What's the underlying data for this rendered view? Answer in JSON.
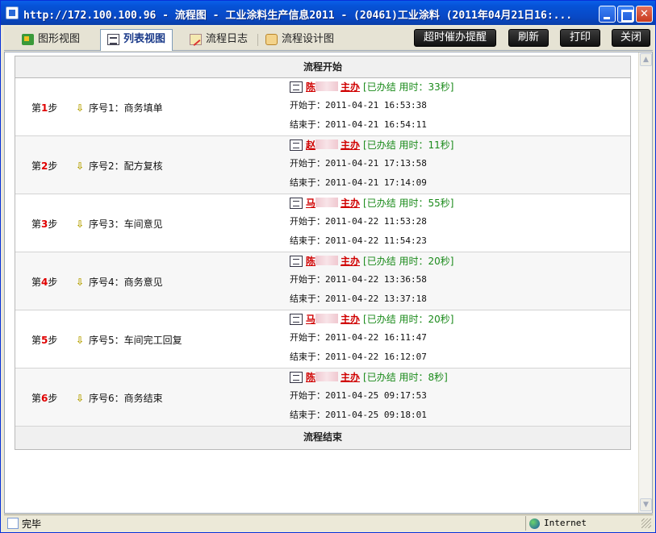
{
  "window": {
    "title": "http://172.100.100.96 - 流程图 - 工业涂料生产信息2011 - (20461)工业涂料 (2011年04月21日16:..."
  },
  "tabs": [
    {
      "label": "图形视图",
      "icon": "graph-view-icon"
    },
    {
      "label": "列表视图",
      "icon": "list-view-icon",
      "active": true
    },
    {
      "label": "流程日志",
      "icon": "log-icon"
    },
    {
      "label": "流程设计图",
      "icon": "design-icon"
    }
  ],
  "actions": {
    "remind": "超时催办提醒",
    "refresh": "刷新",
    "print": "打印",
    "close": "关闭"
  },
  "flow": {
    "start": "流程开始",
    "end": "流程结束",
    "steps": [
      {
        "prefix": "第",
        "num": "1",
        "suffix": "步",
        "seq": "序号1：商务填单",
        "name": "陈",
        "role": "主办",
        "status": "[已办结 用时：33秒]",
        "start": "开始于：2011-04-21 16:53:38",
        "end": "结束于：2011-04-21 16:54:11"
      },
      {
        "prefix": "第",
        "num": "2",
        "suffix": "步",
        "seq": "序号2：配方复核",
        "name": "赵",
        "role": "主办",
        "status": "[已办结 用时：11秒]",
        "start": "开始于：2011-04-21 17:13:58",
        "end": "结束于：2011-04-21 17:14:09"
      },
      {
        "prefix": "第",
        "num": "3",
        "suffix": "步",
        "seq": "序号3：车间意见",
        "name": "马",
        "role": "主办",
        "status": "[已办结 用时：55秒]",
        "start": "开始于：2011-04-22 11:53:28",
        "end": "结束于：2011-04-22 11:54:23"
      },
      {
        "prefix": "第",
        "num": "4",
        "suffix": "步",
        "seq": "序号4：商务意见",
        "name": "陈",
        "role": "主办",
        "status": "[已办结 用时：20秒]",
        "start": "开始于：2011-04-22 13:36:58",
        "end": "结束于：2011-04-22 13:37:18"
      },
      {
        "prefix": "第",
        "num": "5",
        "suffix": "步",
        "seq": "序号5：车间完工回复",
        "name": "马",
        "role": "主办",
        "status": "[已办结 用时：20秒]",
        "start": "开始于：2011-04-22 16:11:47",
        "end": "结束于：2011-04-22 16:12:07"
      },
      {
        "prefix": "第",
        "num": "6",
        "suffix": "步",
        "seq": "序号6：商务结束",
        "name": "陈",
        "role": "主办",
        "status": "[已办结 用时：8秒]",
        "start": "开始于：2011-04-25 09:17:53",
        "end": "结束于：2011-04-25 09:18:01"
      }
    ]
  },
  "statusbar": {
    "text": "完毕",
    "zone": "Internet"
  }
}
